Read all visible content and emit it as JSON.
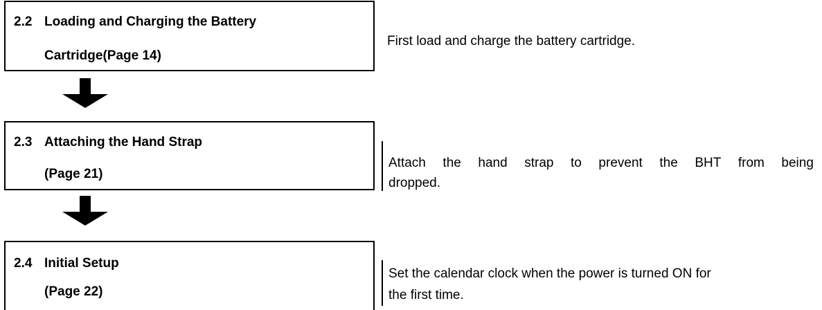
{
  "steps": [
    {
      "number": "2.2",
      "title_line1": "Loading and Charging the Battery",
      "title_line2": "Cartridge(Page 14)",
      "description_line1": "First load and charge the battery cartridge.",
      "description_line2": ""
    },
    {
      "number": "2.3",
      "title_line1": "Attaching the Hand Strap",
      "title_line2": "(Page 21)",
      "description_line1_words": [
        "Attach",
        "the",
        "hand",
        "strap",
        "to",
        "prevent",
        "the",
        "BHT",
        "from",
        "being"
      ],
      "description_line2": "dropped."
    },
    {
      "number": "2.4",
      "title_line1": "Initial Setup",
      "title_line2": "(Page 22)",
      "description_line1": "Set the calendar clock when the power is turned ON for",
      "description_line2": "the first time."
    }
  ]
}
